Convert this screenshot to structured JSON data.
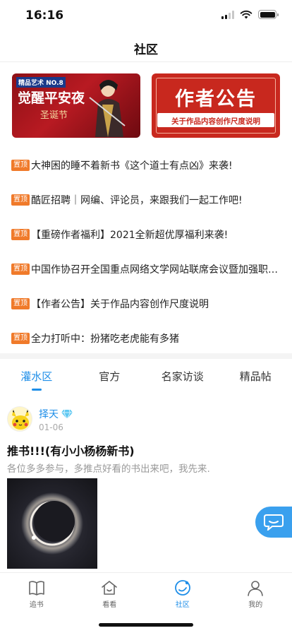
{
  "status_bar": {
    "time": "16:16"
  },
  "nav": {
    "title": "社区"
  },
  "banners": [
    {
      "tag": "精品艺术 NO.8",
      "title": "觉醒平安夜",
      "subtitle": "圣诞节"
    },
    {
      "title": "作者公告",
      "subtitle": "关于作品内容创作尺度说明"
    }
  ],
  "pinned": {
    "tag_label": "置顶",
    "items": [
      "大神困的睡不着新书《这个道士有点凶》来袭!",
      "酷匠招聘｜网编、评论员，来跟我们一起工作吧!",
      "【重磅作者福利】2021全新超优厚福利来袭!",
      "中国作协召开全国重点网络文学网站联席会议暨加强职业道德建设座谈会",
      "【作者公告】关于作品内容创作尺度说明",
      " 全力打听中：扮猪吃老虎能有多猪"
    ]
  },
  "tabs": [
    {
      "label": "灌水区",
      "active": true
    },
    {
      "label": "官方",
      "active": false
    },
    {
      "label": "名家访谈",
      "active": false
    },
    {
      "label": "精品帖",
      "active": false
    }
  ],
  "post": {
    "author": "择天",
    "date": "01-06",
    "title": "推书!!!(有小小杨杨新书)",
    "body": "各位多多参与，多推点好看的书出来吧，我先来."
  },
  "tabbar": [
    {
      "label": "追书",
      "icon": "book-icon",
      "active": false
    },
    {
      "label": "看看",
      "icon": "house-icon",
      "active": false
    },
    {
      "label": "社区",
      "icon": "community-icon",
      "active": true
    },
    {
      "label": "我的",
      "icon": "person-icon",
      "active": false
    }
  ],
  "colors": {
    "accent": "#1e8ee8",
    "pin_tag": "#f07a2a",
    "banner_red": "#c8281e"
  }
}
